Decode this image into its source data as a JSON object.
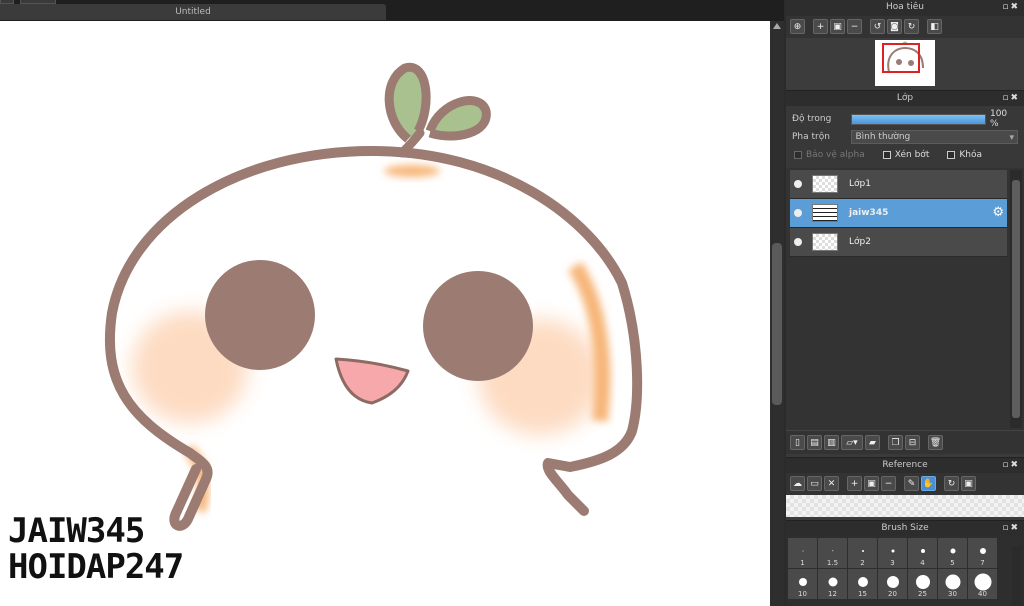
{
  "document": {
    "tab_title": "Untitled"
  },
  "watermark": {
    "line1": "JAIW345",
    "line2": "HOIDAP247"
  },
  "navigator": {
    "title": "Hoa tiêu"
  },
  "layer_panel": {
    "title": "Lớp",
    "opacity_label": "Độ trong",
    "opacity_percent": 100,
    "opacity_text": "100 %",
    "blend_label": "Pha trộn",
    "blend_value": "Bình thường",
    "protect_alpha": "Bảo vệ alpha",
    "clipping": "Xén bớt",
    "lock": "Khóa",
    "layers": [
      {
        "name": "Lớp1",
        "selected": false
      },
      {
        "name": "jaiw345",
        "selected": true
      },
      {
        "name": "Lớp2",
        "selected": false
      }
    ]
  },
  "reference": {
    "title": "Reference"
  },
  "brush_size": {
    "title": "Brush Size",
    "sizes": [
      "1",
      "1.5",
      "2",
      "3",
      "4",
      "5",
      "7",
      "10",
      "12",
      "15",
      "20",
      "25",
      "30",
      "40"
    ]
  },
  "colors": {
    "accent": "#5b9dd6",
    "stroke": "#9b7b72",
    "leaf": "#a9c08f",
    "blush": "#fcd9bf",
    "mouth": "#f4a3a8"
  }
}
